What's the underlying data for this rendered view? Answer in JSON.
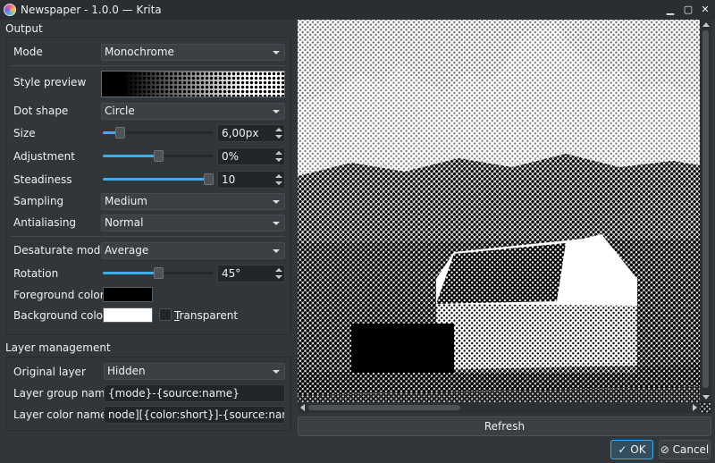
{
  "window": {
    "title": "Newspaper - 1.0.0 — Krita"
  },
  "output": {
    "section_title": "Output",
    "mode": {
      "label": "Mode",
      "value": "Monochrome"
    },
    "style_preview": {
      "label": "Style preview"
    },
    "dot_shape": {
      "label": "Dot shape",
      "value": "Circle"
    },
    "size": {
      "label": "Size",
      "value": "6,00px",
      "level": 0.12
    },
    "adjustment": {
      "label": "Adjustment",
      "value": "0%",
      "level": 0.5
    },
    "steadiness": {
      "label": "Steadiness",
      "value": "10",
      "level": 1.0
    },
    "sampling": {
      "label": "Sampling",
      "value": "Medium"
    },
    "antialiasing": {
      "label": "Antialiasing",
      "value": "Normal"
    },
    "desaturate_mode": {
      "label": "Desaturate mode",
      "value": "Average"
    },
    "rotation": {
      "label": "Rotation",
      "value": "45°",
      "level": 0.5
    },
    "foreground_color": {
      "label": "Foreground color",
      "color": "#000000"
    },
    "background_color": {
      "label": "Background color",
      "color": "#ffffff",
      "transparent_label": "Transparent",
      "transparent_checked": false
    }
  },
  "layer_management": {
    "section_title": "Layer management",
    "original_layer": {
      "label": "Original layer",
      "value": "Hidden"
    },
    "layer_group_name": {
      "label": "Layer group name",
      "value": "{mode}-{source:name}"
    },
    "layer_color_name": {
      "label": "Layer color name",
      "value": "node][{color:short}]-{source:name}"
    }
  },
  "buttons": {
    "refresh": "Refresh",
    "ok": "OK",
    "cancel": "Cancel"
  },
  "colors": {
    "accent": "#3daee9",
    "background": "#31363b"
  }
}
